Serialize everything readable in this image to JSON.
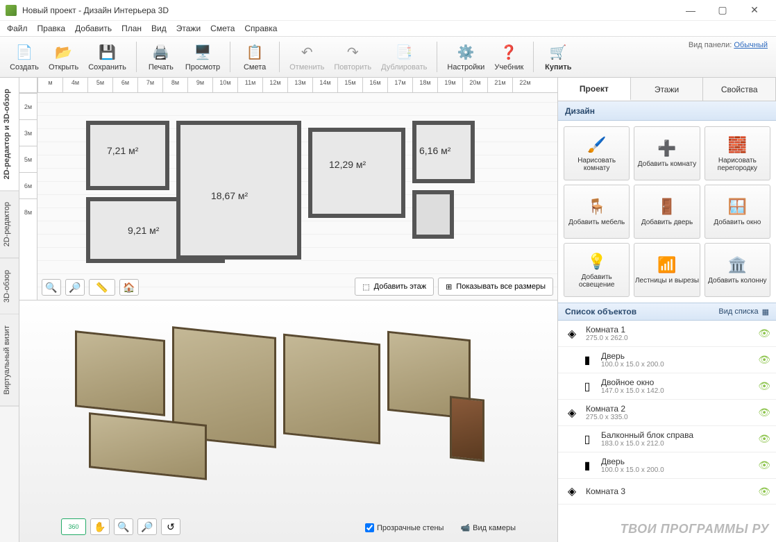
{
  "window": {
    "title": "Новый проект - Дизайн Интерьера 3D"
  },
  "menu": [
    "Файл",
    "Правка",
    "Добавить",
    "План",
    "Вид",
    "Этажи",
    "Смета",
    "Справка"
  ],
  "toolbar": {
    "create": "Создать",
    "open": "Открыть",
    "save": "Сохранить",
    "print": "Печать",
    "preview": "Просмотр",
    "estimate": "Смета",
    "undo": "Отменить",
    "redo": "Повторить",
    "duplicate": "Дублировать",
    "settings": "Настройки",
    "tutorial": "Учебник",
    "buy": "Купить"
  },
  "panel_mode": {
    "label": "Вид панели:",
    "value": "Обычный"
  },
  "sidetabs": [
    "2D-редактор и 3D-обзор",
    "2D-редактор",
    "3D-обзор",
    "Виртуальный визит"
  ],
  "ruler_top": [
    "м",
    "4м",
    "5м",
    "6м",
    "7м",
    "8м",
    "9м",
    "10м",
    "11м",
    "12м",
    "13м",
    "14м",
    "15м",
    "16м",
    "17м",
    "18м",
    "19м",
    "20м",
    "21м",
    "22м"
  ],
  "ruler_left": [
    "2м",
    "3м",
    "5м",
    "6м",
    "8м"
  ],
  "rooms": {
    "r1": "7,21 м²",
    "r2": "18,67 м²",
    "r3": "12,29 м²",
    "r4": "6,16 м²",
    "r5": "9,21 м²"
  },
  "plan_actions": {
    "add_floor": "Добавить этаж",
    "show_dims": "Показывать все размеры"
  },
  "view3d_opts": {
    "transparent": "Прозрачные стены",
    "camera": "Вид камеры"
  },
  "right_tabs": [
    "Проект",
    "Этажи",
    "Свойства"
  ],
  "design_hdr": "Дизайн",
  "design_buttons": [
    "Нарисовать комнату",
    "Добавить комнату",
    "Нарисовать перегородку",
    "Добавить мебель",
    "Добавить дверь",
    "Добавить окно",
    "Добавить освещение",
    "Лестницы и вырезы",
    "Добавить колонну"
  ],
  "list_hdr": "Список объектов",
  "list_mode": "Вид списка",
  "objects": [
    {
      "name": "Комната 1",
      "dims": "275.0 x 262.0",
      "icon": "room",
      "level": 0
    },
    {
      "name": "Дверь",
      "dims": "100.0 x 15.0 x 200.0",
      "icon": "door",
      "level": 1
    },
    {
      "name": "Двойное окно",
      "dims": "147.0 x 15.0 x 142.0",
      "icon": "window",
      "level": 1
    },
    {
      "name": "Комната 2",
      "dims": "275.0 x 335.0",
      "icon": "room",
      "level": 0
    },
    {
      "name": "Балконный блок справа",
      "dims": "183.0 x 15.0 x 212.0",
      "icon": "window",
      "level": 1
    },
    {
      "name": "Дверь",
      "dims": "100.0 x 15.0 x 200.0",
      "icon": "door",
      "level": 1
    },
    {
      "name": "Комната 3",
      "dims": "",
      "icon": "room",
      "level": 0
    }
  ],
  "watermark": "ТВОИ ПРОГРАММЫ РУ"
}
